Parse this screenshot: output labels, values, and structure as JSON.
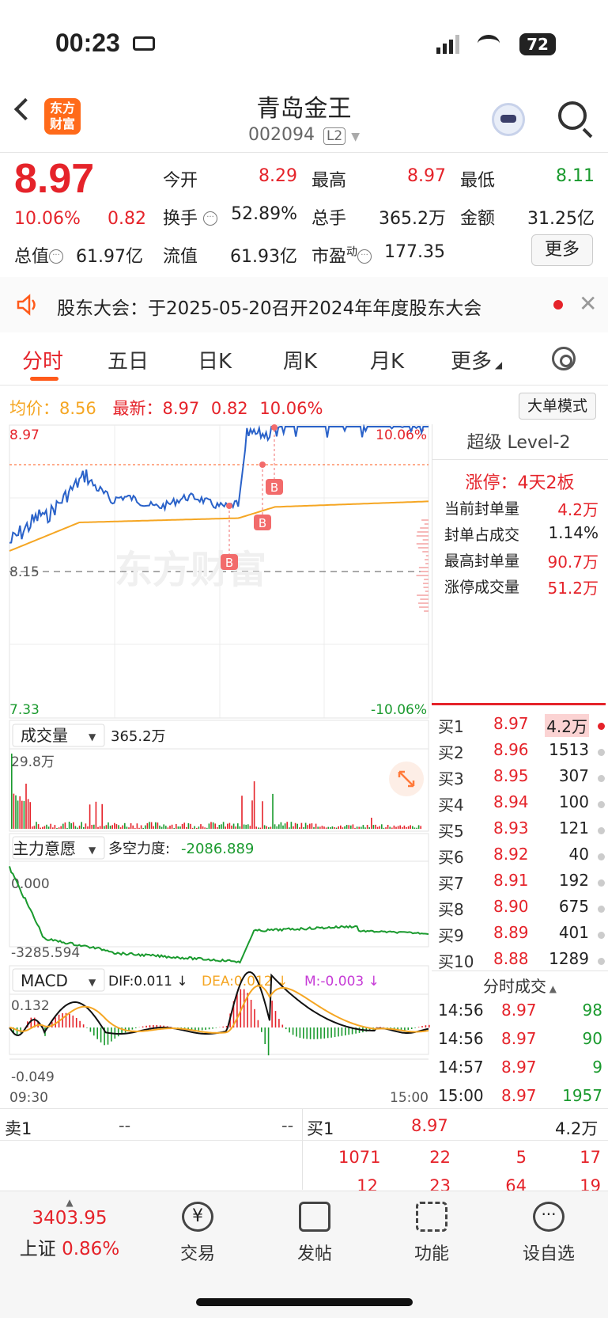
{
  "status_bar": {
    "time": "00:23",
    "battery": "72"
  },
  "header": {
    "logo_text": "东方财富",
    "title": "青岛金王",
    "code": "002094",
    "level_badge": "L2"
  },
  "quote": {
    "price": "8.97",
    "change_pct": "10.06%",
    "change_abs": "0.82",
    "open_label": "今开",
    "open": "8.29",
    "high_label": "最高",
    "high": "8.97",
    "low_label": "最低",
    "low": "8.11",
    "turnover_label": "换手",
    "turnover": "52.89%",
    "volume_label": "总手",
    "volume": "365.2万",
    "amount_label": "金额",
    "amount": "31.25亿",
    "mcap_label": "总值",
    "mcap": "61.97亿",
    "float_label": "流值",
    "float": "61.93亿",
    "pe_label": "市盈",
    "pe_sup": "动",
    "pe": "177.35",
    "more": "更多"
  },
  "notice": {
    "text": "股东大会：于2025-05-20召开2024年年度股东大会"
  },
  "tabs": [
    "分时",
    "五日",
    "日K",
    "周K",
    "月K",
    "更多"
  ],
  "chart_header": {
    "avg_label": "均价：",
    "avg": "8.56",
    "last_label": "最新：",
    "last": "8.97",
    "last_chg": "0.82",
    "last_pct": "10.06%",
    "mode_btn": "大单模式"
  },
  "axis": {
    "top_price": "8.97",
    "top_pct": "10.06%",
    "prev_close": "8.15",
    "bottom_price": "7.33",
    "bottom_pct": "-10.06%",
    "vol_max": "29.8万",
    "vol_label": "成交量",
    "vol_total": "365.2万",
    "zl_label": "主力意愿",
    "zl_power_label": "多空力度:",
    "zl_power": "-2086.889",
    "zl_top": "0.000",
    "zl_bottom": "-3285.594",
    "macd_label": "MACD",
    "dif": "DIF:0.011 ↓",
    "dea": "DEA:0.012 ↓",
    "m": "M:-0.003 ↓",
    "macd_top": "0.132",
    "macd_bottom": "-0.049",
    "time_start": "09:30",
    "time_end": "15:00",
    "buy_marker": "B"
  },
  "level2": {
    "title": "超级 Level-2",
    "limit_label": "涨停：4天2板",
    "stats": [
      {
        "label": "当前封单量",
        "value": "4.2万"
      },
      {
        "label": "封单占成交",
        "value": "1.14%"
      },
      {
        "label": "最高封单量",
        "value": "90.7万"
      },
      {
        "label": "涨停成交量",
        "value": "51.2万"
      }
    ]
  },
  "orderbook": [
    {
      "label": "买1",
      "price": "8.97",
      "vol": "4.2万"
    },
    {
      "label": "买2",
      "price": "8.96",
      "vol": "1513"
    },
    {
      "label": "买3",
      "price": "8.95",
      "vol": "307"
    },
    {
      "label": "买4",
      "price": "8.94",
      "vol": "100"
    },
    {
      "label": "买5",
      "price": "8.93",
      "vol": "121"
    },
    {
      "label": "买6",
      "price": "8.92",
      "vol": "40"
    },
    {
      "label": "买7",
      "price": "8.91",
      "vol": "192"
    },
    {
      "label": "买8",
      "price": "8.90",
      "vol": "675"
    },
    {
      "label": "买9",
      "price": "8.89",
      "vol": "401"
    },
    {
      "label": "买10",
      "price": "8.88",
      "vol": "1289"
    }
  ],
  "ticks": {
    "title": "分时成交",
    "rows": [
      {
        "time": "14:56",
        "price": "8.97",
        "vol": "98"
      },
      {
        "time": "14:56",
        "price": "8.97",
        "vol": "90"
      },
      {
        "time": "14:57",
        "price": "8.97",
        "vol": "9"
      },
      {
        "time": "15:00",
        "price": "8.97",
        "vol": "1957"
      }
    ]
  },
  "bidask": {
    "sell_label": "卖1",
    "sell_price": "--",
    "sell_vol": "--",
    "buy_label": "买1",
    "buy_price": "8.97",
    "buy_vol": "4.2万",
    "queue_row1": [
      "1071",
      "22",
      "5",
      "17"
    ],
    "queue_row2": [
      "12",
      "23",
      "64",
      "19"
    ]
  },
  "bottom_nav": {
    "index_value": "3403.95",
    "index_name": "上证",
    "index_pct": "0.86%",
    "items": [
      "交易",
      "发帖",
      "功能",
      "设自选"
    ]
  },
  "colors": {
    "up": "#e5232a",
    "down": "#1a9a2e",
    "price_line": "#2a62c9",
    "avg_line": "#f5a623",
    "accent": "#ff5a1a"
  }
}
